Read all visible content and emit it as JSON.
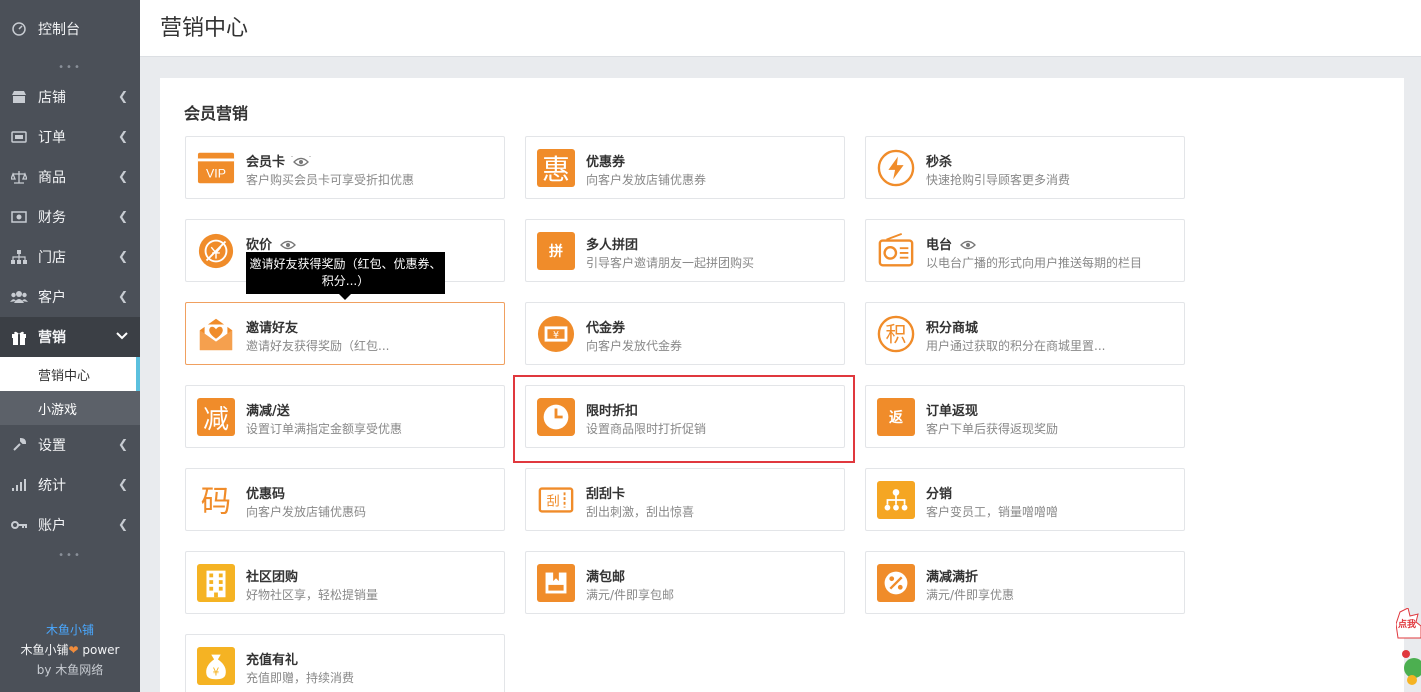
{
  "sidebar": {
    "top_item": {
      "label": "控制台",
      "icon": "dashboard-icon"
    },
    "items": [
      {
        "label": "店铺",
        "icon": "shop-icon"
      },
      {
        "label": "订单",
        "icon": "order-icon"
      },
      {
        "label": "商品",
        "icon": "scale-icon"
      },
      {
        "label": "财务",
        "icon": "finance-icon"
      },
      {
        "label": "门店",
        "icon": "store-tree-icon"
      },
      {
        "label": "客户",
        "icon": "customers-icon"
      },
      {
        "label": "营销",
        "icon": "gift-icon"
      }
    ],
    "sub_items": [
      {
        "label": "营销中心"
      },
      {
        "label": "小游戏"
      }
    ],
    "bottom_items": [
      {
        "label": "设置",
        "icon": "wrench-icon"
      },
      {
        "label": "统计",
        "icon": "stats-icon"
      },
      {
        "label": "账户",
        "icon": "key-icon"
      }
    ],
    "footer": {
      "brand": "木鱼小铺",
      "power_prefix": "木鱼小铺",
      "power_suffix": " power",
      "by": "by 木鱼网络"
    }
  },
  "header": {
    "title": "营销中心"
  },
  "main": {
    "section_title": "会员营销",
    "cards": [
      {
        "title": "会员卡",
        "desc": "客户购买会员卡可享受折扣优惠",
        "icon": "vip-card-icon",
        "eye": true
      },
      {
        "title": "优惠券",
        "desc": "向客户发放店铺优惠券",
        "icon": "hui-coupon-icon"
      },
      {
        "title": "秒杀",
        "desc": "快速抢购引导顾客更多消费",
        "icon": "lightning-icon"
      },
      {
        "title": "砍价",
        "desc": "",
        "icon": "bargain-icon",
        "eye": true
      },
      {
        "title": "多人拼团",
        "desc": "引导客户邀请朋友一起拼团购买",
        "icon": "group-buy-icon"
      },
      {
        "title": "电台",
        "desc": "以电台广播的形式向用户推送每期的栏目",
        "icon": "radio-icon",
        "eye": true
      },
      {
        "title": "邀请好友",
        "desc": "邀请好友获得奖励（红包...",
        "icon": "invite-heart-icon"
      },
      {
        "title": "代金券",
        "desc": "向客户发放代金券",
        "icon": "voucher-icon"
      },
      {
        "title": "积分商城",
        "desc": "用户通过获取的积分在商城里置...",
        "icon": "points-icon"
      },
      {
        "title": "满减/送",
        "desc": "设置订单满指定金额享受优惠",
        "icon": "full-reduce-icon"
      },
      {
        "title": "限时折扣",
        "desc": "设置商品限时打折促销",
        "icon": "clock-icon"
      },
      {
        "title": "订单返现",
        "desc": "客户下单后获得返现奖励",
        "icon": "cashback-icon"
      },
      {
        "title": "优惠码",
        "desc": "向客户发放店铺优惠码",
        "icon": "promo-code-icon"
      },
      {
        "title": "刮刮卡",
        "desc": "刮出刺激，刮出惊喜",
        "icon": "scratch-card-icon"
      },
      {
        "title": "分销",
        "desc": "客户变员工，销量噌噌噌",
        "icon": "distribution-icon"
      },
      {
        "title": "社区团购",
        "desc": "好物社区享，轻松提销量",
        "icon": "building-icon"
      },
      {
        "title": "满包邮",
        "desc": "满元/件即享包邮",
        "icon": "free-shipping-icon"
      },
      {
        "title": "满减满折",
        "desc": "满元/件即享优惠",
        "icon": "percent-icon"
      },
      {
        "title": "充值有礼",
        "desc": "充值即赠，持续消费",
        "icon": "money-bag-icon"
      }
    ],
    "tooltip": "邀请好友获得奖励（红包、优惠券、积分...）",
    "icon_glyphs": {
      "vip": "VIP",
      "hui": "惠",
      "pin": "拼",
      "jian": "减",
      "fan": "返",
      "ma": "码",
      "gua": "刮",
      "ji": "积"
    }
  },
  "widget": {
    "label": "点我"
  },
  "colors": {
    "sidebar_bg": "#4b5058",
    "accent_orange": "#f08c2a",
    "highlight_red": "#e0383e",
    "link_blue": "#4aa8ff"
  }
}
